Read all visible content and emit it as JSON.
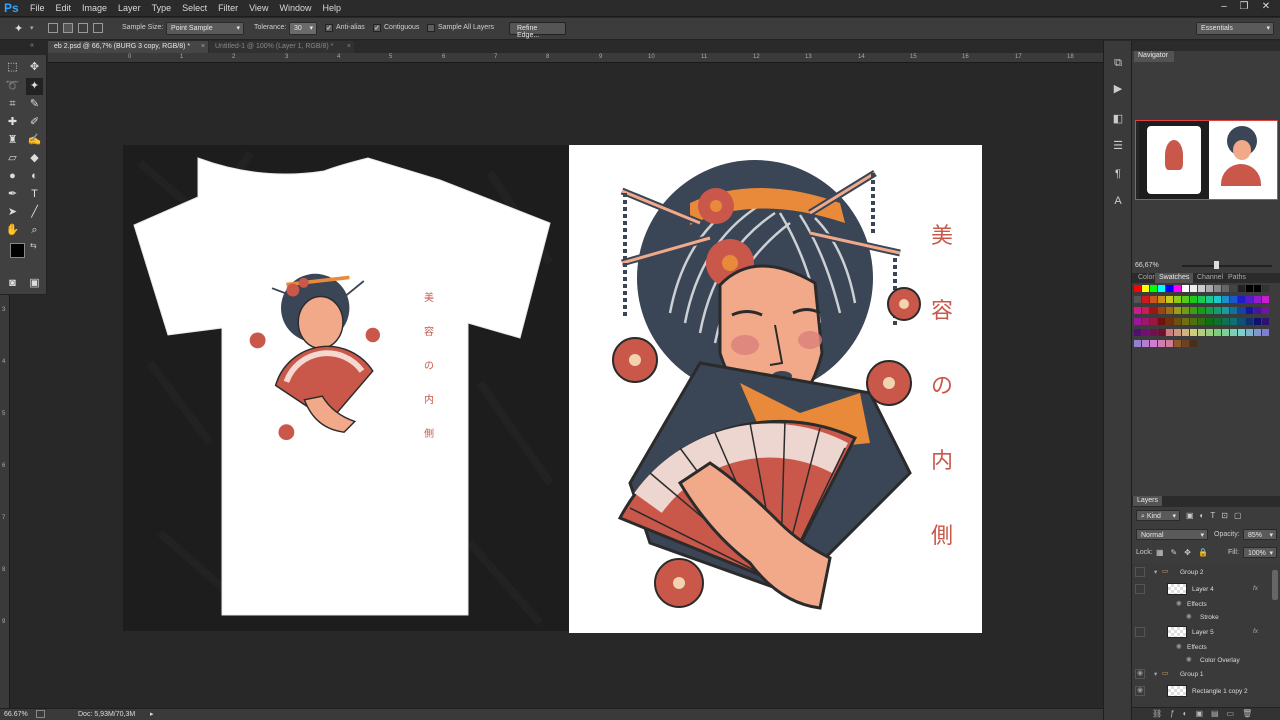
{
  "app": {
    "logo": "Ps",
    "menus": [
      "File",
      "Edit",
      "Image",
      "Layer",
      "Type",
      "Select",
      "Filter",
      "View",
      "Window",
      "Help"
    ]
  },
  "options": {
    "sample_size_label": "Sample Size:",
    "sample_size_value": "Point Sample",
    "tolerance_label": "Tolerance:",
    "tolerance_value": "30",
    "antialias_label": "Anti-alias",
    "contiguous_label": "Contiguous",
    "sample_all_label": "Sample All Layers",
    "refine_edge_label": "Refine Edge...",
    "workspace": "Essentials"
  },
  "tabs": [
    {
      "label": "eb 2.psd @ 66,7% (BURG 3 copy, RGB/8) *",
      "active": true
    },
    {
      "label": "Untitled-1 @ 100% (Layer 1, RGB/8) *",
      "active": false
    }
  ],
  "ruler_top": [
    "0",
    "1",
    "2",
    "3",
    "4",
    "5",
    "6",
    "7",
    "8",
    "9",
    "10",
    "11",
    "12",
    "13",
    "14",
    "15",
    "16",
    "17",
    "18"
  ],
  "ruler_left": [
    "1",
    "2",
    "3",
    "4",
    "5",
    "6",
    "7",
    "8",
    "9"
  ],
  "artwork": {
    "kanji": [
      "美",
      "容",
      "の",
      "内",
      "側"
    ],
    "colors": {
      "salmon": "#f2a98a",
      "hair": "#3a4556",
      "orange": "#e98a3b",
      "red": "#c9584a",
      "canvas": "#ffffff",
      "shirt_bg": "#1c1c1c"
    }
  },
  "status": {
    "zoom": "66.67%",
    "doc": "Doc: 5,93M/70,3M"
  },
  "navigator": {
    "title": "Navigator",
    "zoom": "66,67%"
  },
  "color_panel": {
    "tabs": [
      "Color",
      "Swatches",
      "Channel",
      "Paths"
    ]
  },
  "layers_panel": {
    "title": "Layers",
    "kind_label": "Kind",
    "blend_mode": "Normal",
    "opacity_label": "Opacity:",
    "opacity_value": "85%",
    "lock_label": "Lock:",
    "fill_label": "Fill:",
    "fill_value": "100%",
    "rows": [
      {
        "label": "Group 2",
        "type": "group"
      },
      {
        "label": "Layer 4",
        "type": "layer"
      },
      {
        "label": "Effects",
        "type": "effects"
      },
      {
        "label": "Stroke",
        "type": "effect"
      },
      {
        "label": "Layer 5",
        "type": "layer"
      },
      {
        "label": "Effects",
        "type": "effects"
      },
      {
        "label": "Color Overlay",
        "type": "effect"
      },
      {
        "label": "Group 1",
        "type": "group"
      },
      {
        "label": "Rectangle 1 copy 2",
        "type": "layer"
      }
    ]
  }
}
